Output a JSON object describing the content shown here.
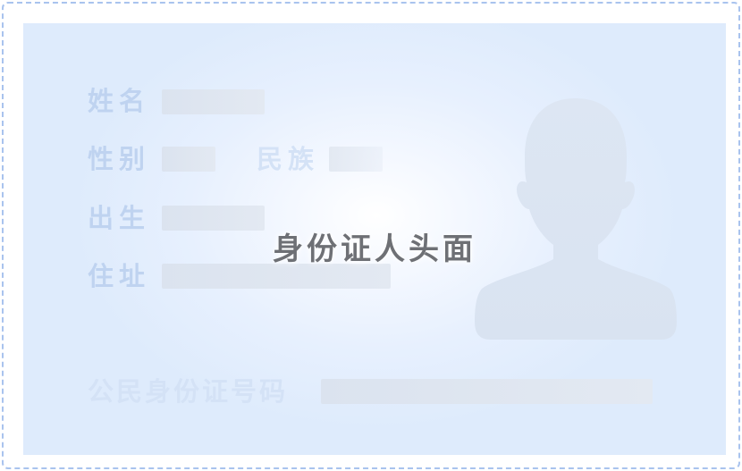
{
  "card": {
    "prompt": "身份证人头面",
    "fields": {
      "name_label": "姓名",
      "gender_label": "性别",
      "ethnicity_label": "民族",
      "birth_label": "出生",
      "address_label": "住址",
      "id_number_label": "公民身份证号码"
    },
    "portrait_icon": "person-silhouette-icon"
  },
  "colors": {
    "border": "#a9c3ee",
    "card_background": "#deebfc",
    "label_text": "#bfd3f0",
    "placeholder_bar": "#dbe3ef",
    "prompt_text": "#6e7075"
  }
}
